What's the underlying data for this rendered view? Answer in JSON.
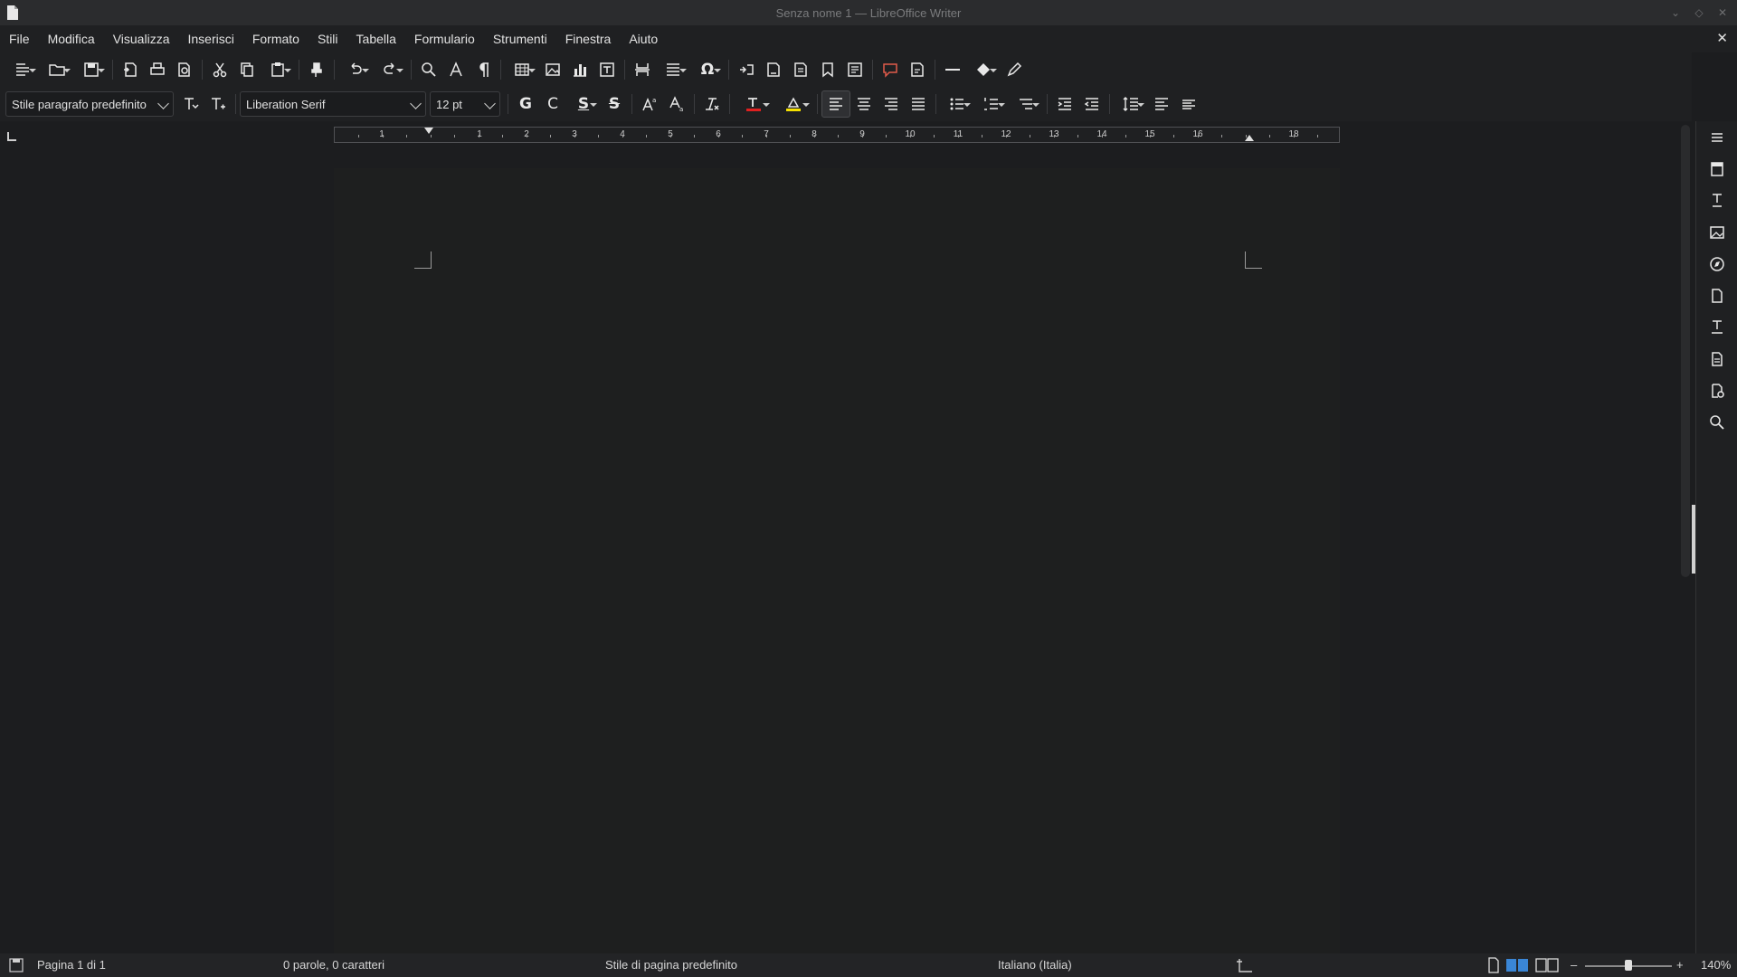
{
  "window": {
    "title": "Senza nome 1 — LibreOffice Writer"
  },
  "menubar": {
    "items": [
      "File",
      "Modifica",
      "Visualizza",
      "Inserisci",
      "Formato",
      "Stili",
      "Tabella",
      "Formulario",
      "Strumenti",
      "Finestra",
      "Aiuto"
    ]
  },
  "formatting": {
    "paragraph_style": "Stile paragrafo predefinito",
    "font_name": "Liberation Serif",
    "font_size": "12 pt",
    "bold_label": "G",
    "italic_label": "C",
    "underline_label": "S",
    "strike_label": "S",
    "font_color": "#e02020",
    "highlight_color": "#f5e000"
  },
  "ruler": {
    "labels": [
      "1",
      "1",
      "2",
      "3",
      "4",
      "5",
      "6",
      "7",
      "8",
      "9",
      "10",
      "11",
      "12",
      "13",
      "14",
      "15",
      "16",
      "18"
    ]
  },
  "statusbar": {
    "page": "Pagina 1 di 1",
    "words": "0 parole, 0 caratteri",
    "page_style": "Stile di pagina predefinito",
    "language": "Italiano (Italia)",
    "zoom": "140%",
    "zoom_level": 0.5
  },
  "icons": {
    "toolbar1": [
      "new-document-icon",
      "open-icon",
      "save-icon",
      "export-pdf-icon",
      "print-icon",
      "print-preview-icon",
      "cut-icon",
      "copy-icon",
      "paste-icon",
      "clone-formatting-icon",
      "undo-icon",
      "redo-icon",
      "find-replace-icon",
      "spelling-icon",
      "formatting-marks-icon",
      "insert-table-icon",
      "insert-image-icon",
      "insert-chart-icon",
      "insert-textbox-icon",
      "page-break-icon",
      "insert-field-icon",
      "special-character-icon",
      "hyperlink-icon",
      "footnote-icon",
      "endnote-icon",
      "bookmark-icon",
      "cross-reference-icon",
      "comment-icon",
      "track-changes-icon",
      "line-icon",
      "basic-shapes-icon",
      "draw-icon"
    ],
    "sidebar": [
      "sidebar-menu-icon",
      "properties-icon",
      "styles-icon",
      "gallery-icon",
      "navigator-icon",
      "page-icon",
      "style-inspector-icon",
      "manage-changes-icon",
      "design-icon",
      "find-icon"
    ]
  }
}
